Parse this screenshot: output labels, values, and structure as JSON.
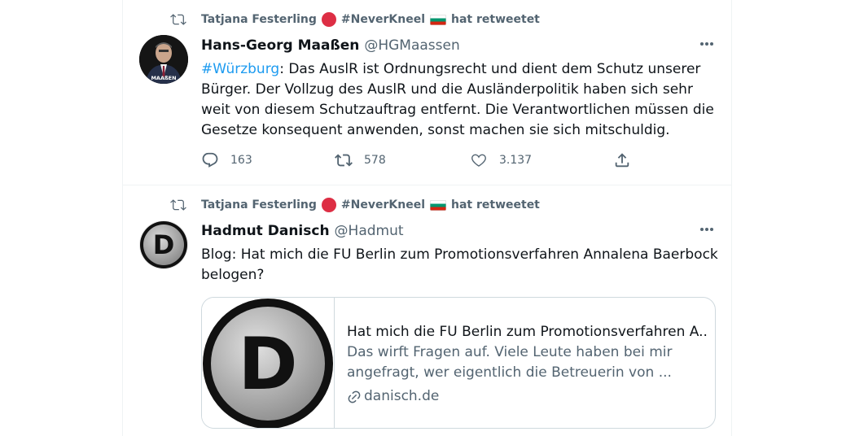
{
  "tweets": [
    {
      "retweeted_by": "Tatjana Festerling",
      "retweet_hashtag": "#NeverKneel",
      "retweet_suffix": "hat retweetet",
      "author_name": "Hans-Georg Maaßen",
      "author_handle": "@HGMaassen",
      "avatar_caption": "MAAßEN",
      "text_hashtag": "#Würzburg",
      "text_lines": [
        ": Das AuslR ist Ordnungsrecht und dient dem Schutz unserer",
        "Bürger. Der Vollzug des AuslR und die Ausländerpolitik haben sich sehr",
        "weit von diesem Schutzauftrag entfernt. Die Verantwortlichen müssen die",
        "Gesetze konsequent anwenden, sonst machen sie sich mitschuldig."
      ],
      "reply_count": "163",
      "retweet_count": "578",
      "like_count": "3.137"
    },
    {
      "retweeted_by": "Tatjana Festerling",
      "retweet_hashtag": "#NeverKneel",
      "retweet_suffix": "hat retweetet",
      "author_name": "Hadmut Danisch",
      "author_handle": "@Hadmut",
      "avatar_letter": "D",
      "text_lines": [
        "Blog: Hat mich die FU Berlin zum Promotionsverfahren Annalena Baerbock",
        "belogen?"
      ],
      "card": {
        "logo_letter": "D",
        "title": "Hat mich die FU Berlin zum Promotionsverfahren A..",
        "description_lines": [
          "Das wirft Fragen auf. Viele Leute haben bei mir",
          "angefragt, wer eigentlich die Betreuerin von ..."
        ],
        "domain": "danisch.de"
      }
    }
  ],
  "colors": {
    "text": "#0f1419",
    "secondary": "#536471",
    "link": "#1d9bf0",
    "border": "#cfd9de",
    "red_dot": "#dd2e44"
  },
  "icons": [
    "retweet-icon",
    "more-icon",
    "reply-icon",
    "like-icon",
    "share-icon",
    "link-icon"
  ]
}
